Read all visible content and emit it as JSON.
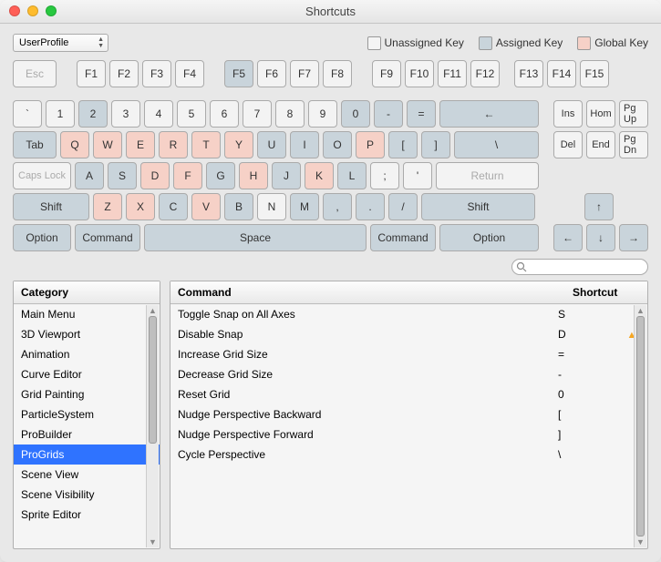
{
  "window": {
    "title": "Shortcuts"
  },
  "profile": {
    "label": "UserProfile"
  },
  "legend": {
    "unassigned": "Unassigned Key",
    "assigned": "Assigned Key",
    "global": "Global Key"
  },
  "keyboard": {
    "esc": "Esc",
    "f1": "F1",
    "f2": "F2",
    "f3": "F3",
    "f4": "F4",
    "f5": "F5",
    "f6": "F6",
    "f7": "F7",
    "f8": "F8",
    "f9": "F9",
    "f10": "F10",
    "f11": "F11",
    "f12": "F12",
    "f13": "F13",
    "f14": "F14",
    "f15": "F15",
    "backtick": "`",
    "n1": "1",
    "n2": "2",
    "n3": "3",
    "n4": "4",
    "n5": "5",
    "n6": "6",
    "n7": "7",
    "n8": "8",
    "n9": "9",
    "n0": "0",
    "minus": "-",
    "equals": "=",
    "back": "←",
    "ins": "Ins",
    "home": "Hom",
    "pgup": "Pg Up",
    "tab": "Tab",
    "q": "Q",
    "w": "W",
    "e": "E",
    "r": "R",
    "t": "T",
    "y": "Y",
    "u": "U",
    "i": "I",
    "o": "O",
    "p": "P",
    "lb": "[",
    "rb": "]",
    "bslash": "\\",
    "del": "Del",
    "end": "End",
    "pgdn": "Pg Dn",
    "caps": "Caps Lock",
    "a": "A",
    "s": "S",
    "d": "D",
    "f": "F",
    "g": "G",
    "h": "H",
    "j": "J",
    "k": "K",
    "l": "L",
    "semi": ";",
    "apos": "'",
    "ret": "Return",
    "lshift": "Shift",
    "z": "Z",
    "x": "X",
    "c": "C",
    "v": "V",
    "b": "B",
    "n": "N",
    "m": "M",
    "comma": ",",
    "period": ".",
    "slash": "/",
    "rshift": "Shift",
    "up": "↑",
    "lopt": "Option",
    "lcmd": "Command",
    "space": "Space",
    "rcmd": "Command",
    "ropt": "Option",
    "left": "←",
    "down": "↓",
    "right": "→"
  },
  "panes": {
    "category_header": "Category",
    "command_header": "Command",
    "shortcut_header": "Shortcut",
    "categories": [
      "Main Menu",
      "3D Viewport",
      "Animation",
      "Curve Editor",
      "Grid Painting",
      "ParticleSystem",
      "ProBuilder",
      "ProGrids",
      "Scene View",
      "Scene Visibility",
      "Sprite Editor"
    ],
    "selected_category_index": 7,
    "commands": [
      {
        "name": "Toggle Snap on All Axes",
        "key": "S",
        "warn": false
      },
      {
        "name": "Disable Snap",
        "key": "D",
        "warn": true
      },
      {
        "name": "Increase Grid Size",
        "key": "=",
        "warn": false
      },
      {
        "name": "Decrease Grid Size",
        "key": "-",
        "warn": false
      },
      {
        "name": "Reset Grid",
        "key": "0",
        "warn": false
      },
      {
        "name": "Nudge Perspective Backward",
        "key": "[",
        "warn": false
      },
      {
        "name": "Nudge Perspective Forward",
        "key": "]",
        "warn": false
      },
      {
        "name": "Cycle Perspective",
        "key": "\\",
        "warn": false
      }
    ]
  }
}
